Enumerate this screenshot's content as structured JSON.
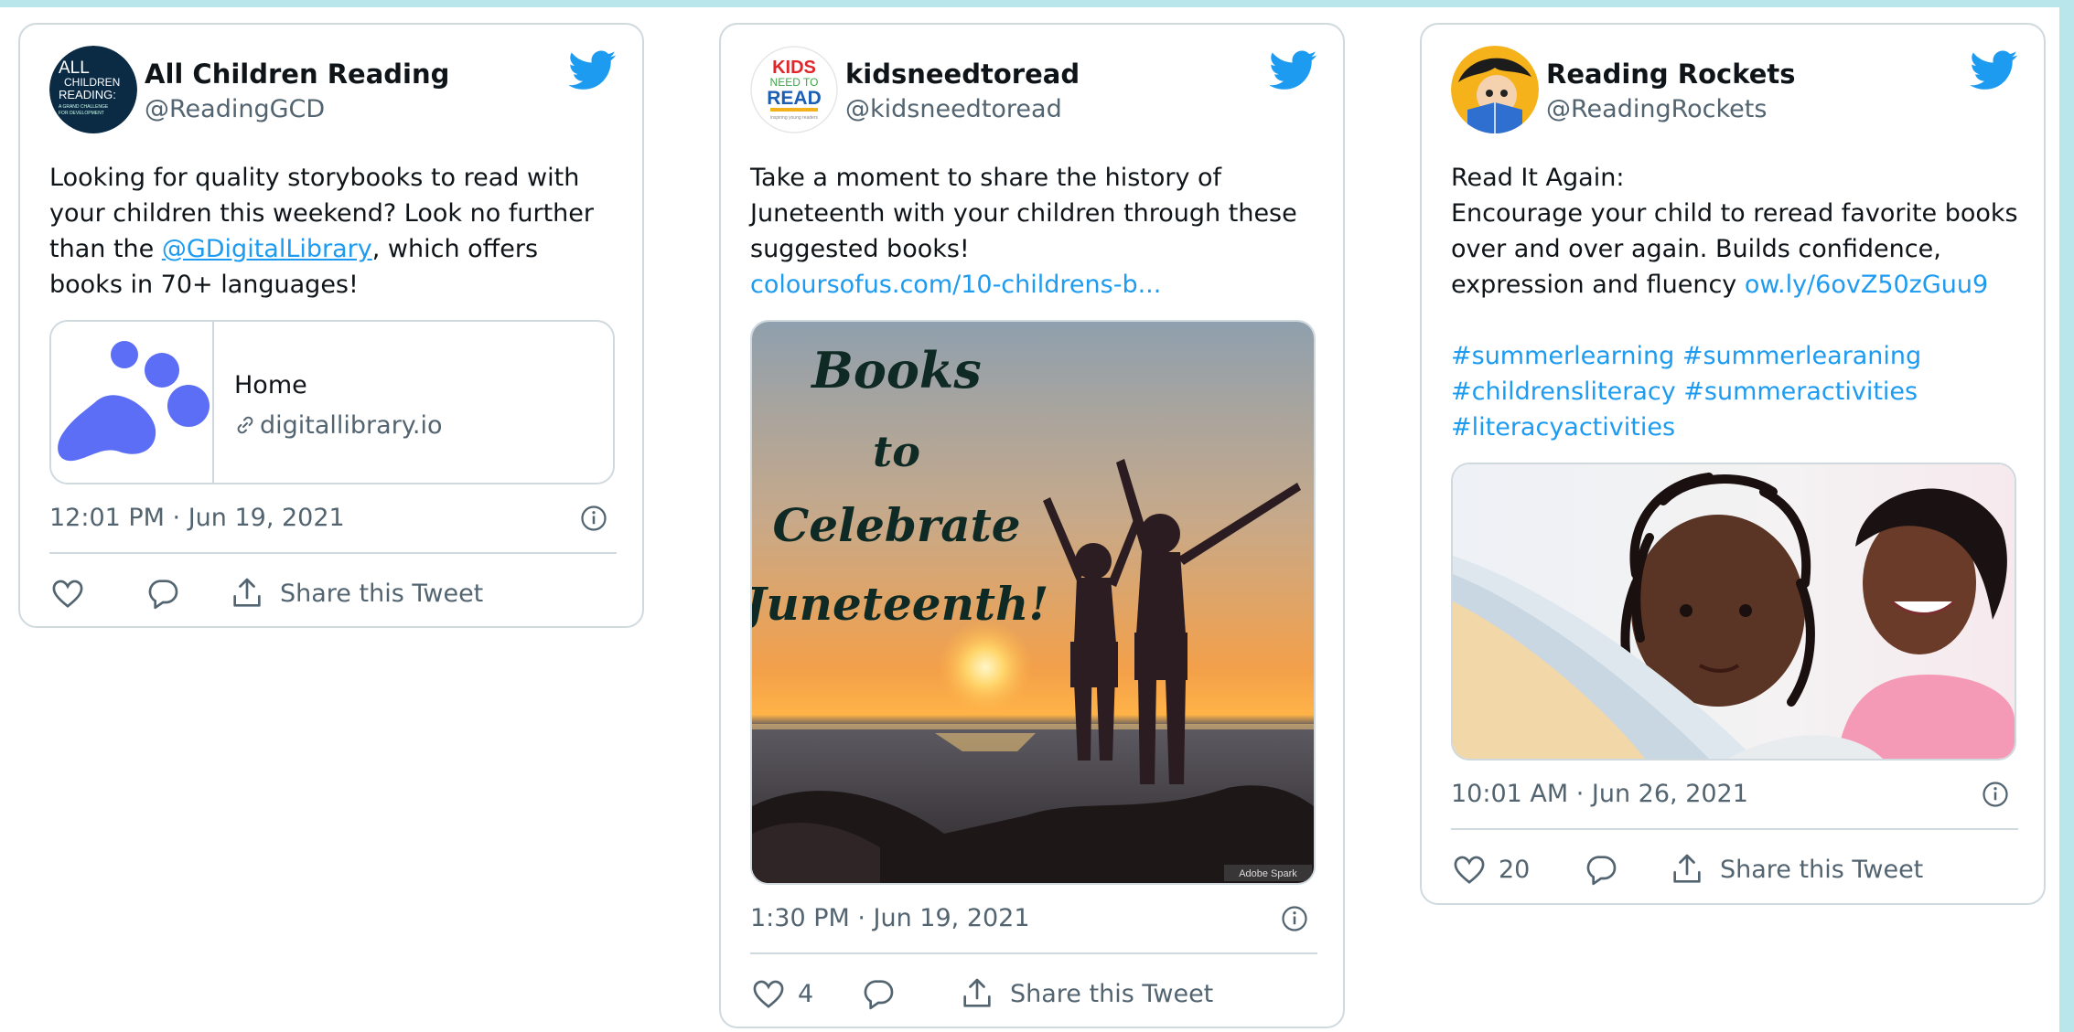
{
  "tweets": [
    {
      "name": "All Children Reading",
      "handle": "@ReadingGCD",
      "avatar_lines": [
        "ALL",
        "CHILDREN",
        "READING:",
        "A GRAND CHALLENGE",
        "FOR DEVELOPMENT"
      ],
      "text_before": "Looking for quality storybooks to read with your children this weekend? Look no further than the ",
      "mention": "@GDigitalLibrary",
      "text_after": ", which offers books in 70+ languages!",
      "link_card": {
        "title": "Home",
        "domain": "digitallibrary.io"
      },
      "timestamp": "12:01 PM · Jun 19, 2021",
      "likes": "",
      "share_label": "Share this Tweet"
    },
    {
      "name": "kidsneedtoread",
      "handle": "@kidsneedtoread",
      "avatar_lines": [
        "KIDS",
        "NEED TO",
        "READ",
        "inspiring young readers"
      ],
      "text": "Take a moment to share the history of Juneteenth with your children through these suggested books!",
      "link": "coloursofus.com/10-childrens-b...",
      "image_text": [
        "Books",
        "to",
        "Celebrate",
        "Juneteenth!"
      ],
      "image_watermark": "Adobe Spark",
      "timestamp": "1:30 PM · Jun 19, 2021",
      "likes": "4",
      "share_label": "Share this Tweet"
    },
    {
      "name": "Reading Rockets",
      "handle": "@ReadingRockets",
      "text_line1": "Read It Again:",
      "text_line2": "Encourage your child to reread favorite books over and over again. Builds confidence, expression and fluency ",
      "link": "ow.ly/6ovZ50zGuu9",
      "hashtags": "#summerlearning #summerlearaning #childrensliteracy #summeractivities #literacyactivities",
      "timestamp": "10:01 AM · Jun 26, 2021",
      "likes": "20",
      "share_label": "Share this Tweet"
    }
  ],
  "colors": {
    "accent": "#1d9bf0",
    "text": "#0f1419",
    "secondary": "#536471",
    "border": "#cfd9de",
    "frame": "#b9e6ea",
    "library_blue": "#5b6ef5"
  },
  "icons": [
    "twitter-bird-icon",
    "info-icon",
    "heart-icon",
    "reply-icon",
    "share-icon",
    "link-icon"
  ]
}
